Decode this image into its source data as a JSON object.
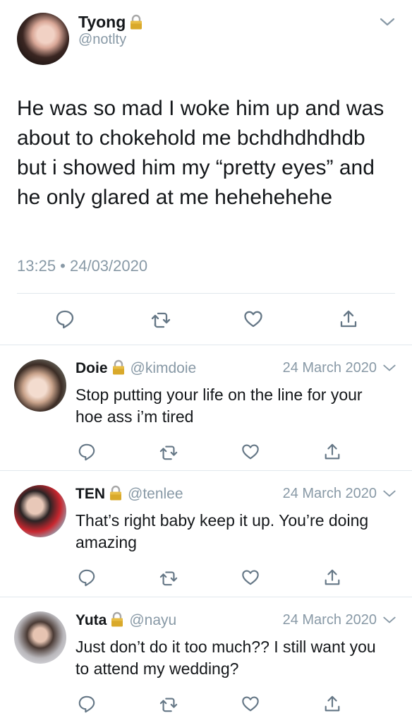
{
  "main_tweet": {
    "author_name": "Tyong",
    "author_handle": "@notlty",
    "text": "He was so mad I woke him up and was about to chokehold me bchdhdhdhdb but i showed him my “pretty eyes” and he only glared at me hehehehehe",
    "timestamp": "13:25 • 24/03/2020"
  },
  "replies": [
    {
      "name": "Doie",
      "handle": "@kimdoie",
      "date": "24 March 2020",
      "text": "Stop putting your life on the line for your hoe ass i’m tired"
    },
    {
      "name": "TEN",
      "handle": "@tenlee",
      "date": "24 March 2020",
      "text": "That’s right baby keep it up. You’re doing amazing"
    },
    {
      "name": "Yuta",
      "handle": "@nayu",
      "date": "24 March 2020",
      "text": "Just don’t do it too much?? I still want you to attend my wedding?"
    }
  ],
  "icons": {
    "lock": "lock-icon",
    "chevron": "chevron-down-icon",
    "reply": "reply-icon",
    "retweet": "retweet-icon",
    "like": "heart-icon",
    "share": "share-icon"
  },
  "colors": {
    "text": "#14171a",
    "muted": "#8899a6",
    "divider": "#e1e8ed",
    "lock_gold": "#d9a92b"
  }
}
